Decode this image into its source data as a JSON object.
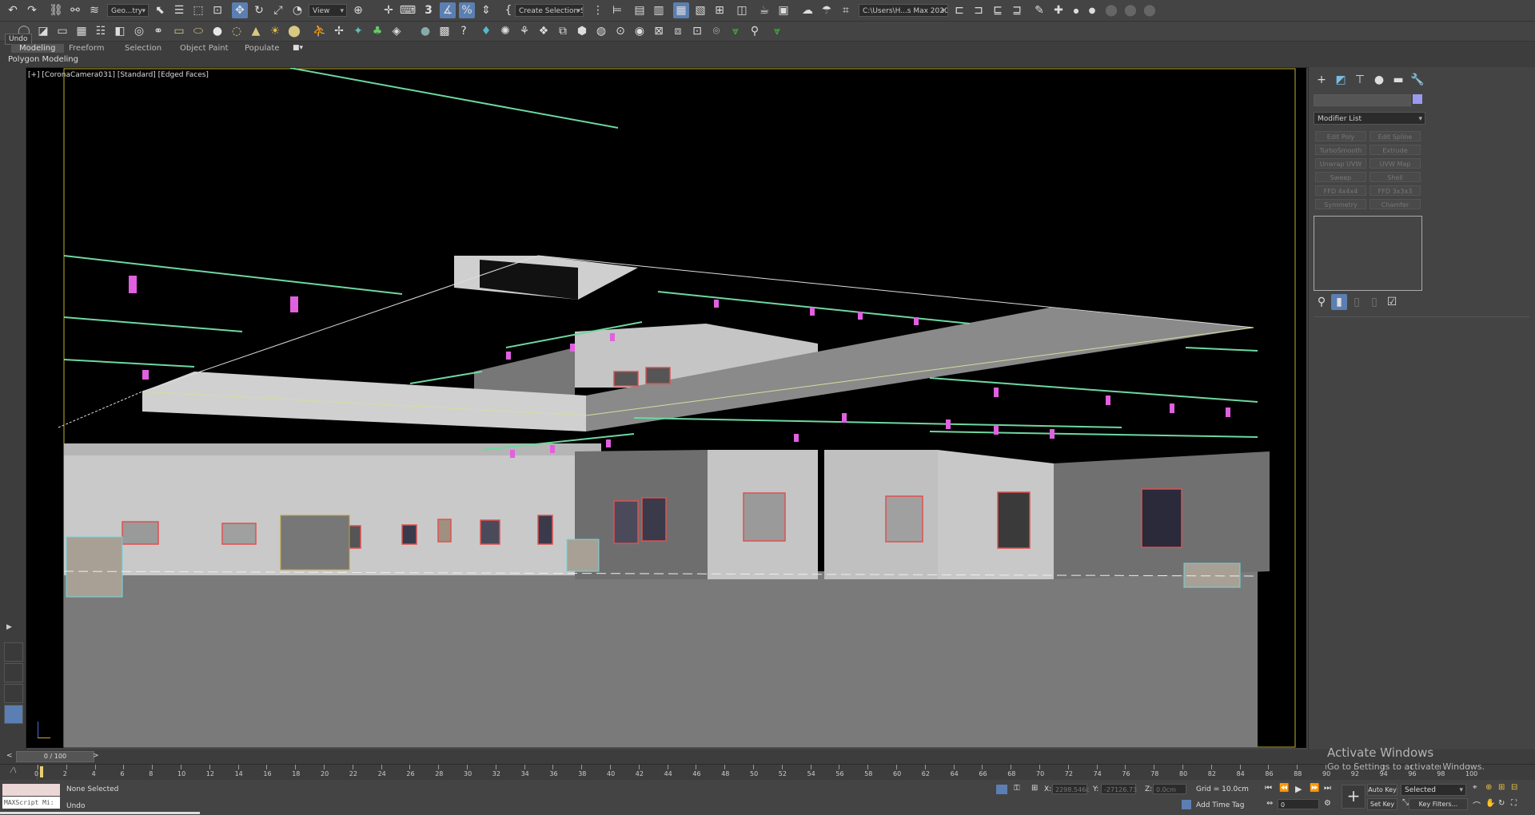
{
  "toolbar": {
    "geometry_dropdown": "Geo...try",
    "view_dropdown": "View",
    "selection_set": "Create Selection Se",
    "project_path": "C:\\Users\\H...s Max 2020",
    "undo_tooltip": "Undo"
  },
  "ribbon": {
    "tabs": [
      "Modeling",
      "Freeform",
      "Selection",
      "Object Paint",
      "Populate"
    ],
    "panel_label": "Polygon Modeling"
  },
  "viewport": {
    "label": "[+] [CoronaCamera031] [Standard] [Edged Faces]",
    "axis_label": "x y z"
  },
  "command_panel": {
    "modifier_list": "Modifier List",
    "modifiers": [
      "Edit Poly",
      "Edit Spline",
      "TurboSmooth",
      "Extrude",
      "Unwrap UVW",
      "UVW Map",
      "Sweep",
      "Shell",
      "FFD 4x4x4",
      "FFD 3x3x3",
      "Symmetry",
      "Chamfer"
    ],
    "accent_color": "#9a9af0"
  },
  "timeline": {
    "frame_counter": "0 / 100",
    "ticks": [
      "0",
      "2",
      "4",
      "6",
      "8",
      "10",
      "12",
      "14",
      "16",
      "18",
      "20",
      "22",
      "24",
      "26",
      "28",
      "30",
      "32",
      "34",
      "36",
      "38",
      "40",
      "42",
      "44",
      "46",
      "48",
      "50",
      "52",
      "54",
      "56",
      "58",
      "60",
      "62",
      "64",
      "66",
      "68",
      "70",
      "72",
      "74",
      "76",
      "78",
      "80",
      "82",
      "84",
      "86",
      "88",
      "90",
      "92",
      "94",
      "96",
      "98",
      "100"
    ],
    "current_frame": 0
  },
  "status": {
    "selection": "None Selected",
    "prompt": "Undo",
    "script_label": "MAXScript Mi:",
    "x_label": "X:",
    "x_value": "2298.546c",
    "y_label": "Y:",
    "y_value": "-27126.73",
    "z_label": "Z:",
    "z_value": "0.0cm",
    "grid": "Grid = 10.0cm",
    "add_time_tag": "Add Time Tag",
    "auto_key": "Auto Key",
    "set_key": "Set Key",
    "selected_dropdown": "Selected",
    "key_filters": "Key Filters...",
    "frame_field": "0"
  },
  "watermark": {
    "title": "Activate Windows",
    "subtitle": "Go to Settings to activate Windows."
  }
}
